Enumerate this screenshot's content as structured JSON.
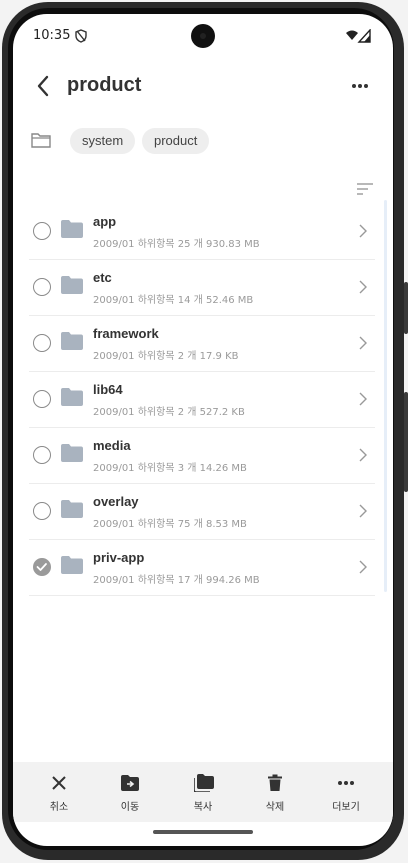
{
  "status": {
    "time": "10:35"
  },
  "header": {
    "title": "product"
  },
  "breadcrumb": {
    "items": [
      "system",
      "product"
    ]
  },
  "files": [
    {
      "name": "app",
      "meta": "2009/01 하위항목 25 개 930.83 MB",
      "checked": false
    },
    {
      "name": "etc",
      "meta": "2009/01 하위항목 14 개 52.46 MB",
      "checked": false
    },
    {
      "name": "framework",
      "meta": "2009/01 하위항목 2 개 17.9 KB",
      "checked": false
    },
    {
      "name": "lib64",
      "meta": "2009/01 하위항목 2 개 527.2 KB",
      "checked": false
    },
    {
      "name": "media",
      "meta": "2009/01 하위항목 3 개 14.26 MB",
      "checked": false
    },
    {
      "name": "overlay",
      "meta": "2009/01 하위항목 75 개 8.53 MB",
      "checked": false
    },
    {
      "name": "priv-app",
      "meta": "2009/01 하위항목 17 개 994.26 MB",
      "checked": true
    }
  ],
  "bottom_bar": {
    "cancel": "취소",
    "move": "이동",
    "copy": "복사",
    "delete": "삭제",
    "more": "더보기"
  },
  "colors": {
    "folder": "#a9b3bf",
    "chip_bg": "#eeeeee",
    "bar_bg": "#f2f2f2"
  }
}
